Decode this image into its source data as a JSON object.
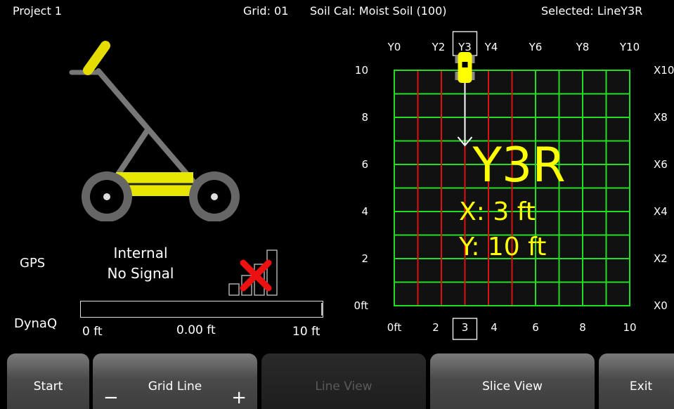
{
  "header": {
    "project": "Project 1",
    "grid": "Grid: 01",
    "soil_cal": "Soil Cal: Moist Soil (100)",
    "selected": "Selected: LineY3R"
  },
  "left_panel": {
    "gps_label": "GPS",
    "gps_status_line1": "Internal",
    "gps_status_line2": "No Signal",
    "gps_signal_bars": 0,
    "dynaq_label": "DynaQ",
    "dynaq_progress": 0.0,
    "dynaq_start": "0 ft",
    "dynaq_value": "0.00 ft",
    "dynaq_end": "10 ft"
  },
  "grid_view": {
    "top_labels": [
      "Y0",
      "Y2",
      "Y3",
      "Y4",
      "Y6",
      "Y8",
      "Y10"
    ],
    "left_labels": [
      "10",
      "8",
      "6",
      "4",
      "2",
      "0ft"
    ],
    "right_labels": [
      "X10",
      "X8",
      "X6",
      "X4",
      "X2",
      "X0"
    ],
    "bottom_labels": [
      "0ft",
      "2",
      "3",
      "4",
      "6",
      "8",
      "10"
    ],
    "selected_line": "Y3R",
    "selected_top_label": "Y3",
    "selected_bottom_label": "3",
    "x_readout": "X: 3 ft",
    "y_readout": "Y: 10 ft",
    "x_range": [
      0,
      10
    ],
    "y_range": [
      0,
      10
    ],
    "cart_position": {
      "x": 3,
      "y": 10
    }
  },
  "buttons": {
    "start": "Start",
    "grid_line": "Grid Line",
    "grid_line_minus": "−",
    "grid_line_plus": "+",
    "line_view": "Line View",
    "slice_view": "Slice View",
    "exit": "Exit"
  },
  "colors": {
    "grid_green": "#22dd22",
    "grid_red": "#dd1111",
    "accent_yellow": "#ffff00",
    "error_red": "#ee1111"
  }
}
